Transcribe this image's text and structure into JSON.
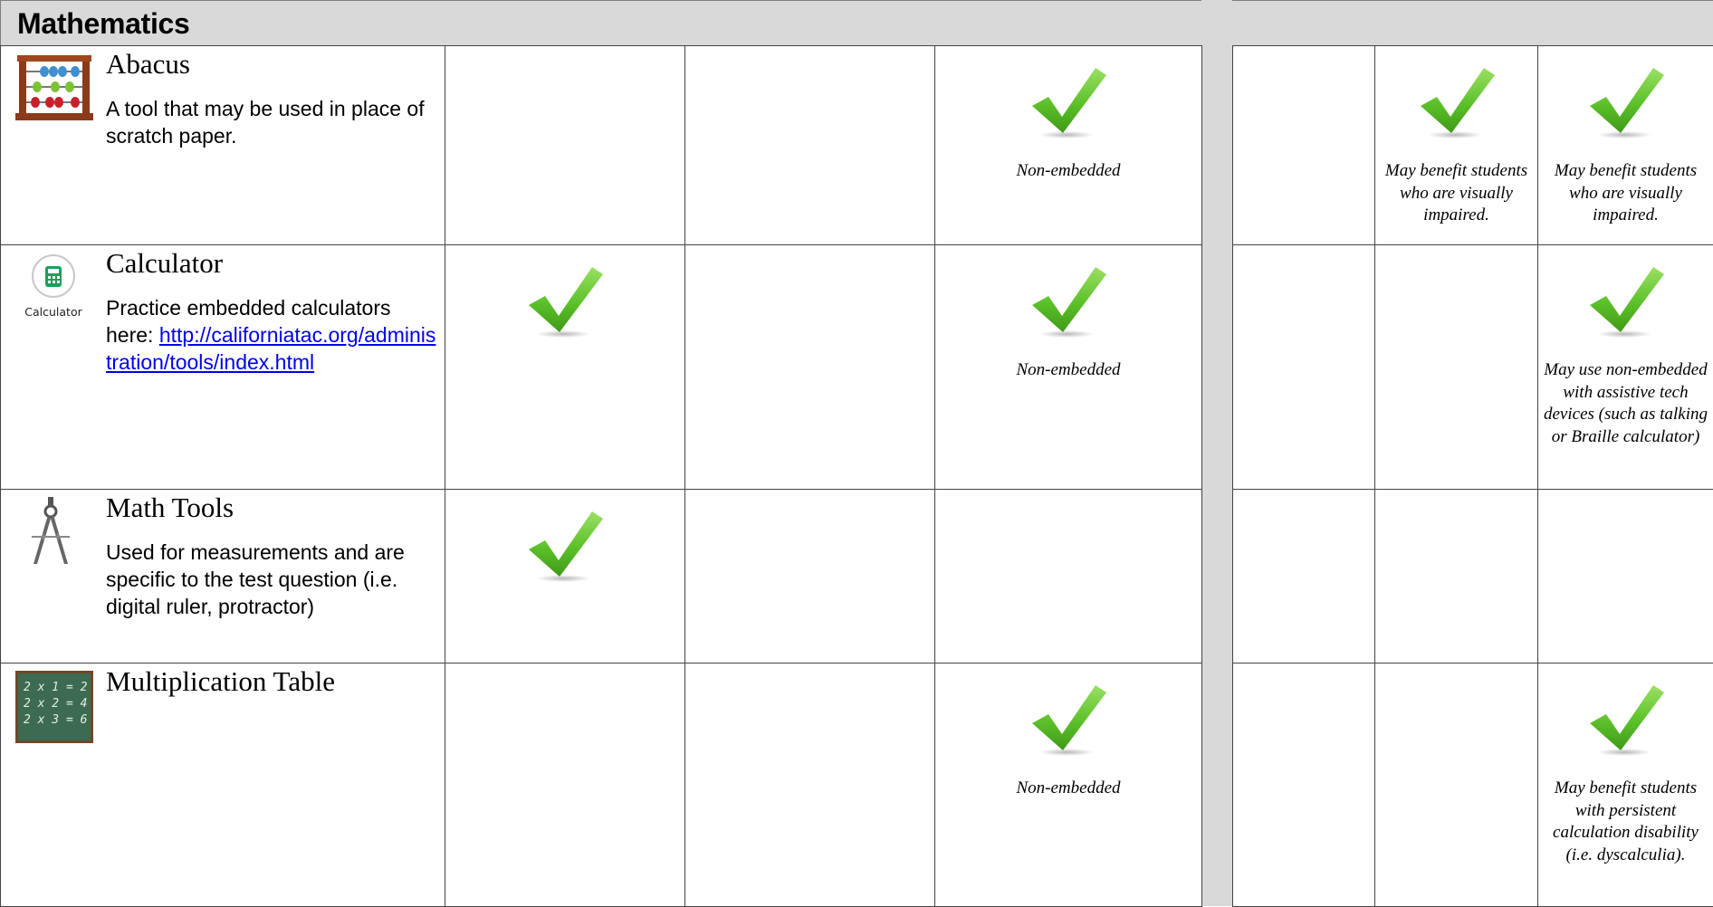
{
  "section": {
    "title": "Mathematics"
  },
  "tools": [
    {
      "name": "Abacus",
      "icon": "abacus-icon",
      "description": "A tool that may be used in place of scratch paper.",
      "link": "",
      "left_cells": [
        {
          "check": false,
          "note": ""
        },
        {
          "check": false,
          "note": ""
        },
        {
          "check": true,
          "note": "Non-embedded"
        }
      ],
      "right_cells": [
        {
          "check": false,
          "note": ""
        },
        {
          "check": true,
          "note": "May benefit students who are visually impaired."
        },
        {
          "check": true,
          "note": "May benefit students who are visually impaired."
        }
      ]
    },
    {
      "name": "Calculator",
      "icon": "calculator-icon",
      "icon_label": "Calculator",
      "description": "Practice embedded calculators here:",
      "link": "http://californiatac.org/administration/tools/index.html",
      "left_cells": [
        {
          "check": true,
          "note": ""
        },
        {
          "check": false,
          "note": ""
        },
        {
          "check": true,
          "note": "Non-embedded"
        }
      ],
      "right_cells": [
        {
          "check": false,
          "note": ""
        },
        {
          "check": false,
          "note": ""
        },
        {
          "check": true,
          "note": "May use non-embedded with assistive tech devices (such as talking  or Braille calculator)"
        }
      ]
    },
    {
      "name": "Math Tools",
      "icon": "compass-icon",
      "description": "Used for measurements and are specific to the test question (i.e. digital ruler, protractor)",
      "link": "",
      "left_cells": [
        {
          "check": true,
          "note": ""
        },
        {
          "check": false,
          "note": ""
        },
        {
          "check": false,
          "note": ""
        }
      ],
      "right_cells": [
        {
          "check": false,
          "note": ""
        },
        {
          "check": false,
          "note": ""
        },
        {
          "check": false,
          "note": ""
        }
      ]
    },
    {
      "name": "Multiplication Table",
      "icon": "chalkboard-icon",
      "board_lines": [
        "2 x 1 = 2",
        "2 x 2 = 4",
        "2 x 3 = 6"
      ],
      "description": "",
      "link": "",
      "left_cells": [
        {
          "check": false,
          "note": ""
        },
        {
          "check": false,
          "note": ""
        },
        {
          "check": true,
          "note": "Non-embedded"
        }
      ],
      "right_cells": [
        {
          "check": false,
          "note": ""
        },
        {
          "check": false,
          "note": ""
        },
        {
          "check": true,
          "note": "May benefit students with persistent calculation disability (i.e. dyscalculia)."
        }
      ]
    }
  ],
  "colors": {
    "check_green": "#5cc12a",
    "header_gray": "#d9d9d9",
    "link_blue": "#0000ee"
  }
}
